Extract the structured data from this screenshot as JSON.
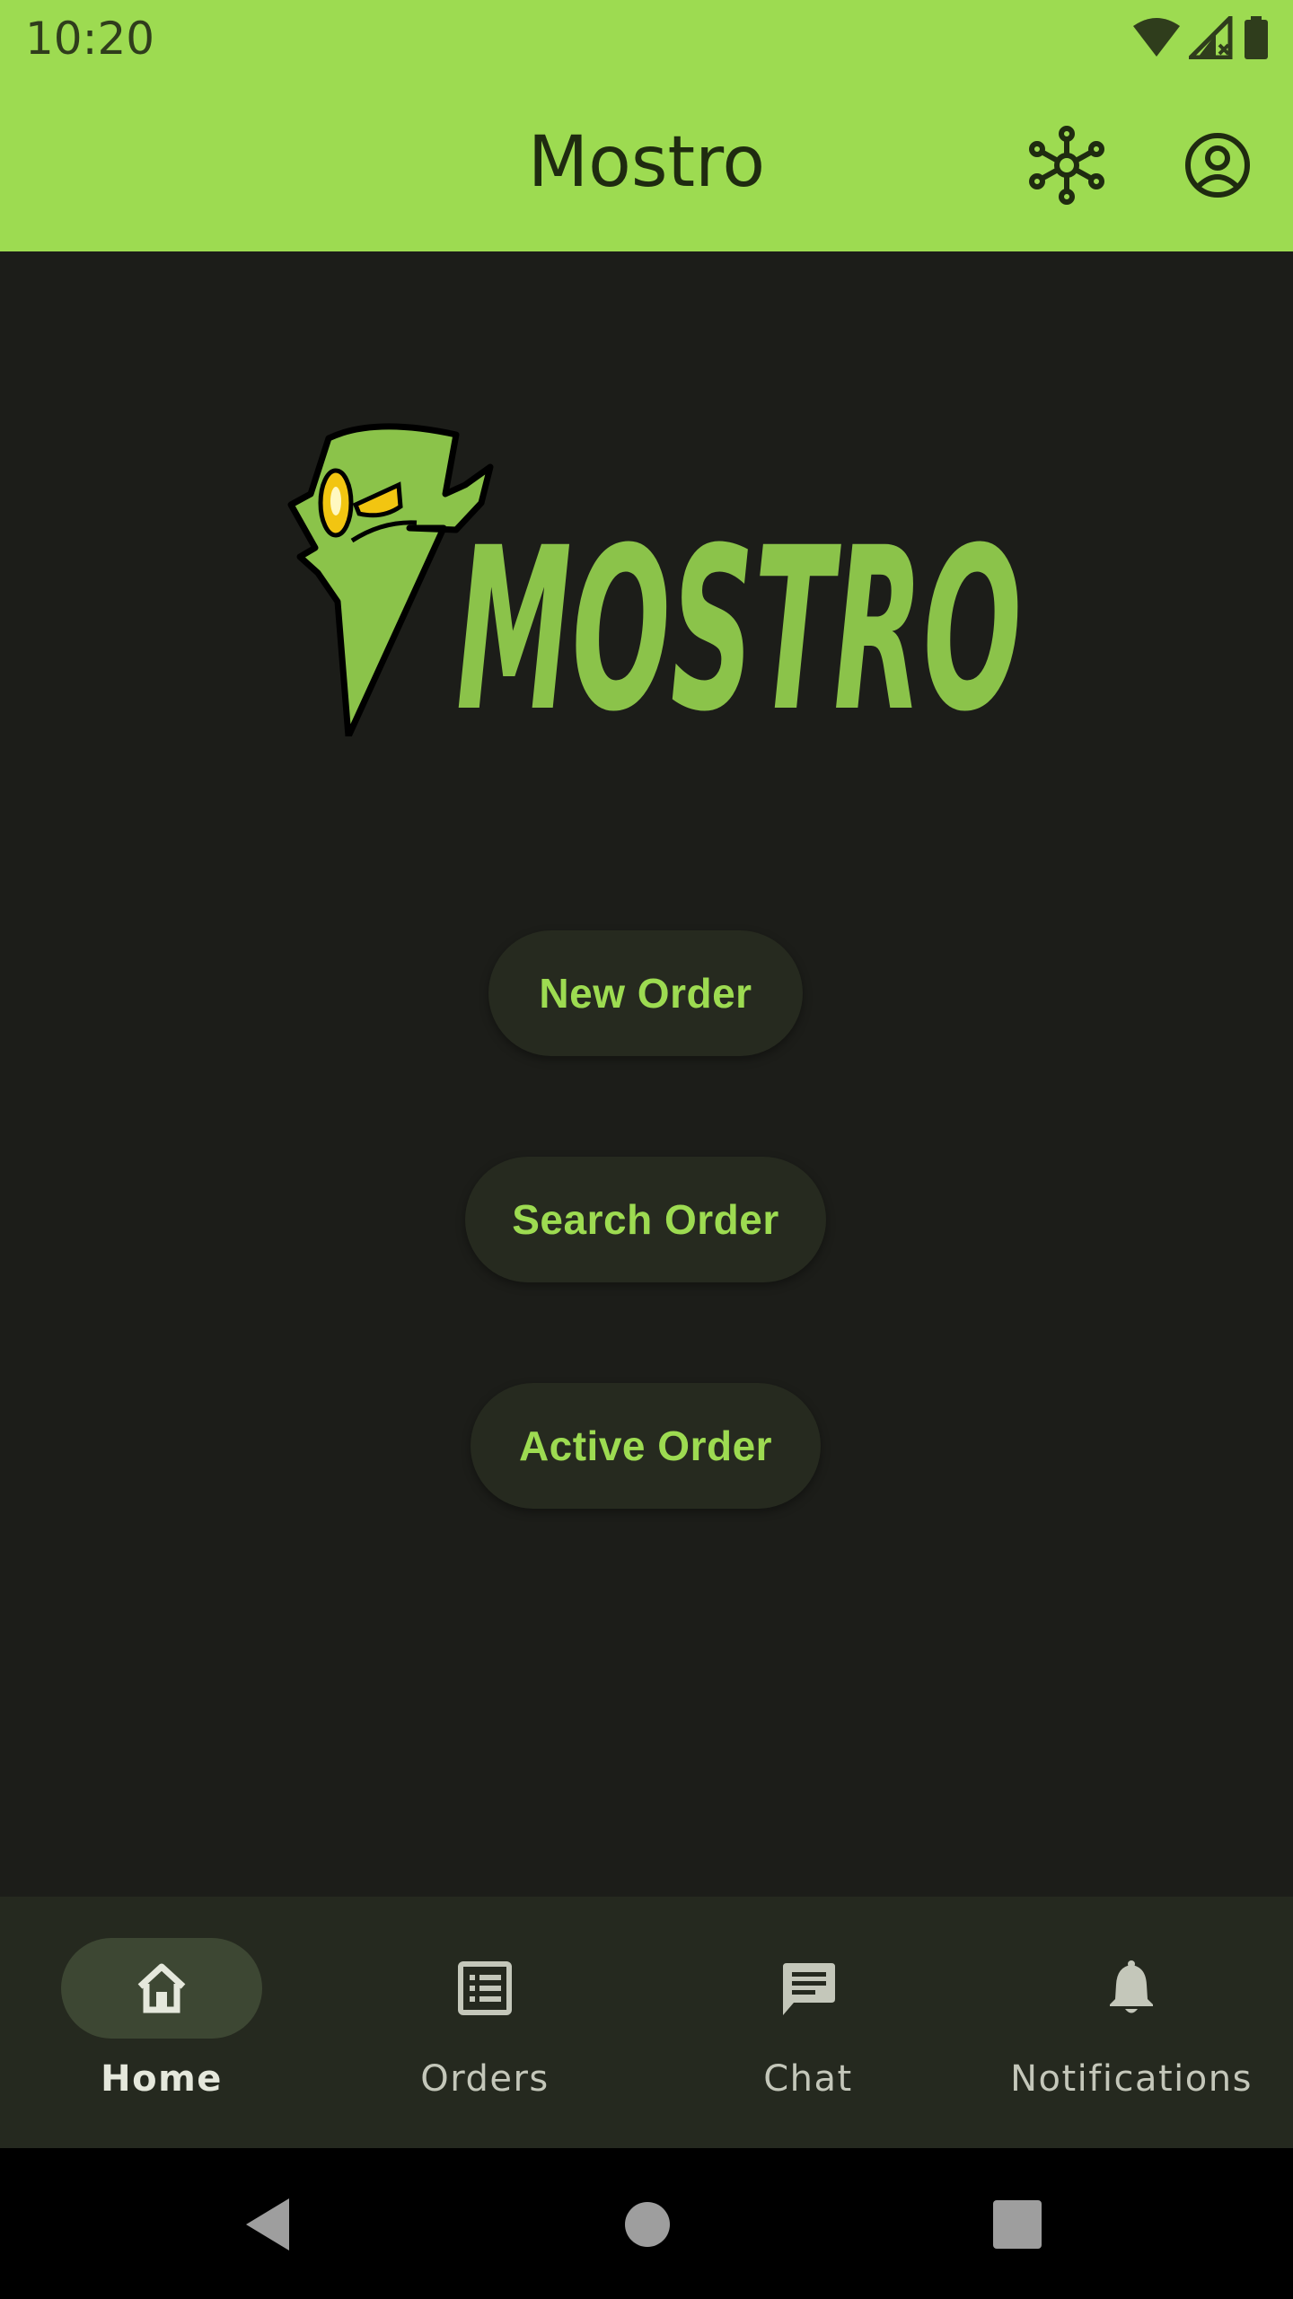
{
  "status_bar": {
    "time": "10:20",
    "icons": [
      "wifi-icon",
      "signal-icon",
      "battery-icon"
    ]
  },
  "app_bar": {
    "title": "Mostro",
    "actions": [
      {
        "name": "relays-icon",
        "label": ""
      },
      {
        "name": "account-icon",
        "label": ""
      }
    ]
  },
  "logo": {
    "text": "MOSTRO"
  },
  "main": {
    "buttons": [
      {
        "label": "New Order"
      },
      {
        "label": "Search Order"
      },
      {
        "label": "Active Order"
      }
    ]
  },
  "bottom_nav": {
    "items": [
      {
        "label": "Home",
        "icon": "home-icon",
        "active": true
      },
      {
        "label": "Orders",
        "icon": "list-icon",
        "active": false
      },
      {
        "label": "Chat",
        "icon": "chat-icon",
        "active": false
      },
      {
        "label": "Notifications",
        "icon": "bell-icon",
        "active": false
      }
    ]
  },
  "colors": {
    "accent": "#9ddb51",
    "background": "#1c1d19",
    "button_bg": "#262a1f",
    "nav_bg": "#25291f",
    "active_pill": "#3d4733"
  }
}
